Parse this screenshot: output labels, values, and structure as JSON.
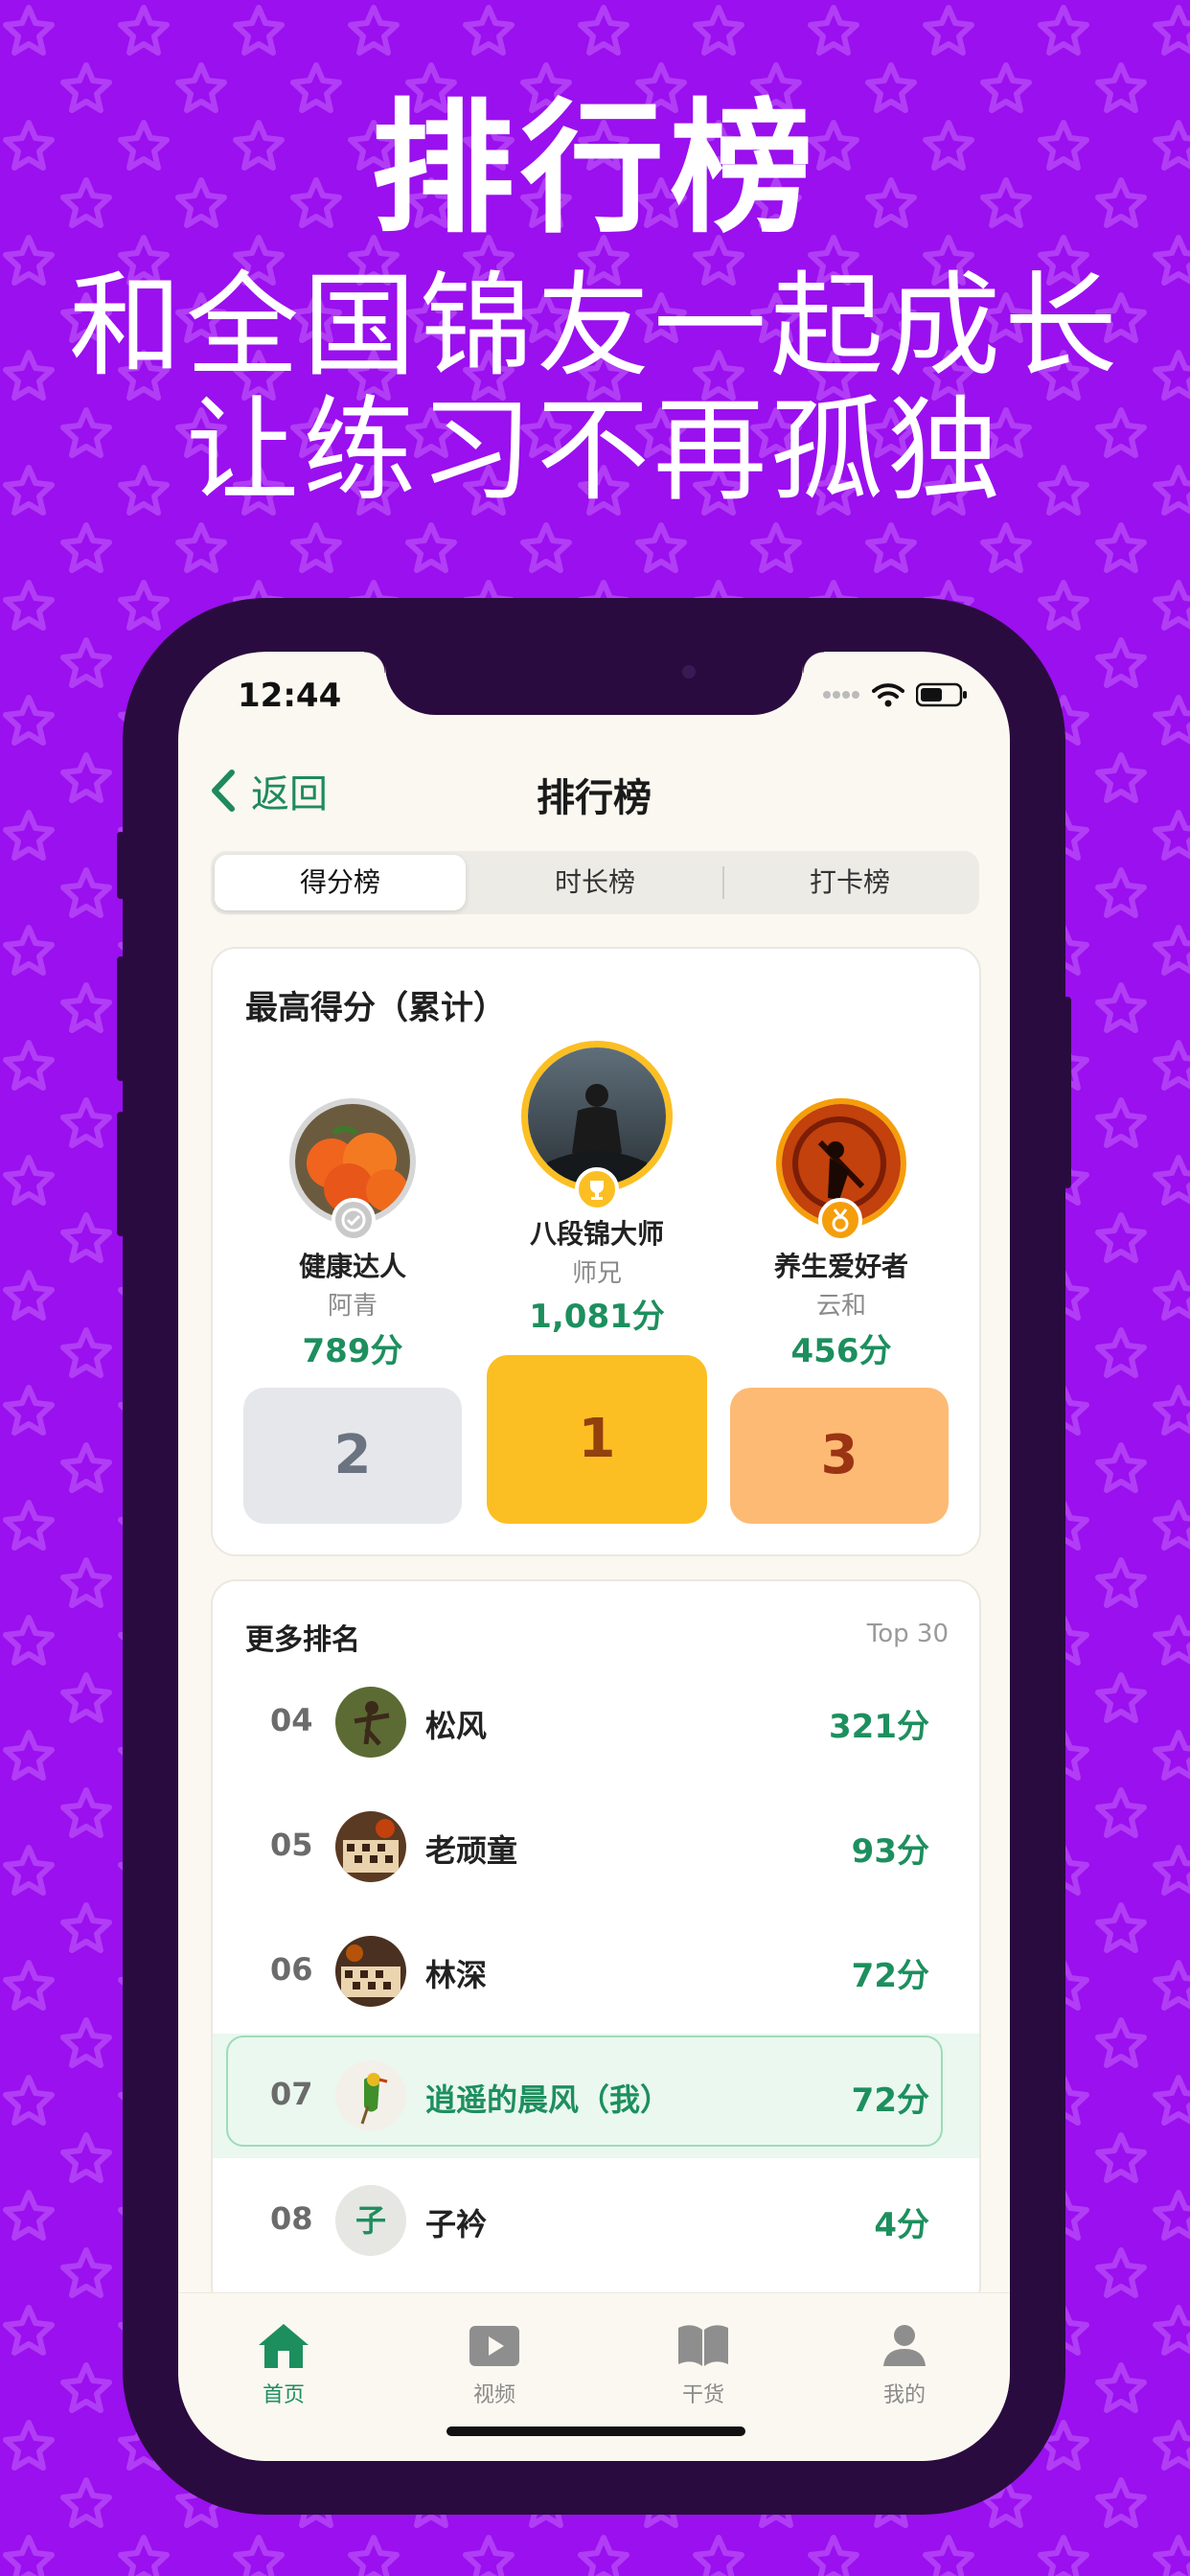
{
  "hero": {
    "title": "排行榜",
    "line1": "和全国锦友一起成长",
    "line2": "让练习不再孤独"
  },
  "status_bar": {
    "time": "12:44"
  },
  "navbar": {
    "back_label": "返回",
    "title": "排行榜"
  },
  "segments": {
    "items": [
      "得分榜",
      "时长榜",
      "打卡榜"
    ],
    "active": "得分榜"
  },
  "podium": {
    "title": "最高得分（累计）",
    "first": {
      "rank": "1",
      "name": "八段锦大师",
      "title": "师兄",
      "score": "1,081分"
    },
    "second": {
      "rank": "2",
      "name": "健康达人",
      "title": "阿青",
      "score": "789分"
    },
    "third": {
      "rank": "3",
      "name": "养生爱好者",
      "title": "云和",
      "score": "456分"
    }
  },
  "more_ranks": {
    "title": "更多排名",
    "limit_label": "Top 30",
    "rows": [
      {
        "rank": "04",
        "name": "松风",
        "score": "321分"
      },
      {
        "rank": "05",
        "name": "老顽童",
        "score": "93分"
      },
      {
        "rank": "06",
        "name": "林深",
        "score": "72分"
      },
      {
        "rank": "07",
        "name": "逍遥的晨风（我）",
        "score": "72分",
        "is_me": true
      },
      {
        "rank": "08",
        "name": "子衿",
        "score": "4分",
        "avatar_text": "子"
      }
    ]
  },
  "tabbar": {
    "items": [
      {
        "label": "首页",
        "icon": "home-icon",
        "active": true
      },
      {
        "label": "视频",
        "icon": "play-icon"
      },
      {
        "label": "干货",
        "icon": "book-icon"
      },
      {
        "label": "我的",
        "icon": "person-icon"
      }
    ]
  },
  "colors": {
    "background": "#9a10ee",
    "accent_green": "#1d8f5e",
    "gold": "#fbbf24",
    "silver_block": "#e5e7eb",
    "bronze_block": "#fdba74"
  }
}
